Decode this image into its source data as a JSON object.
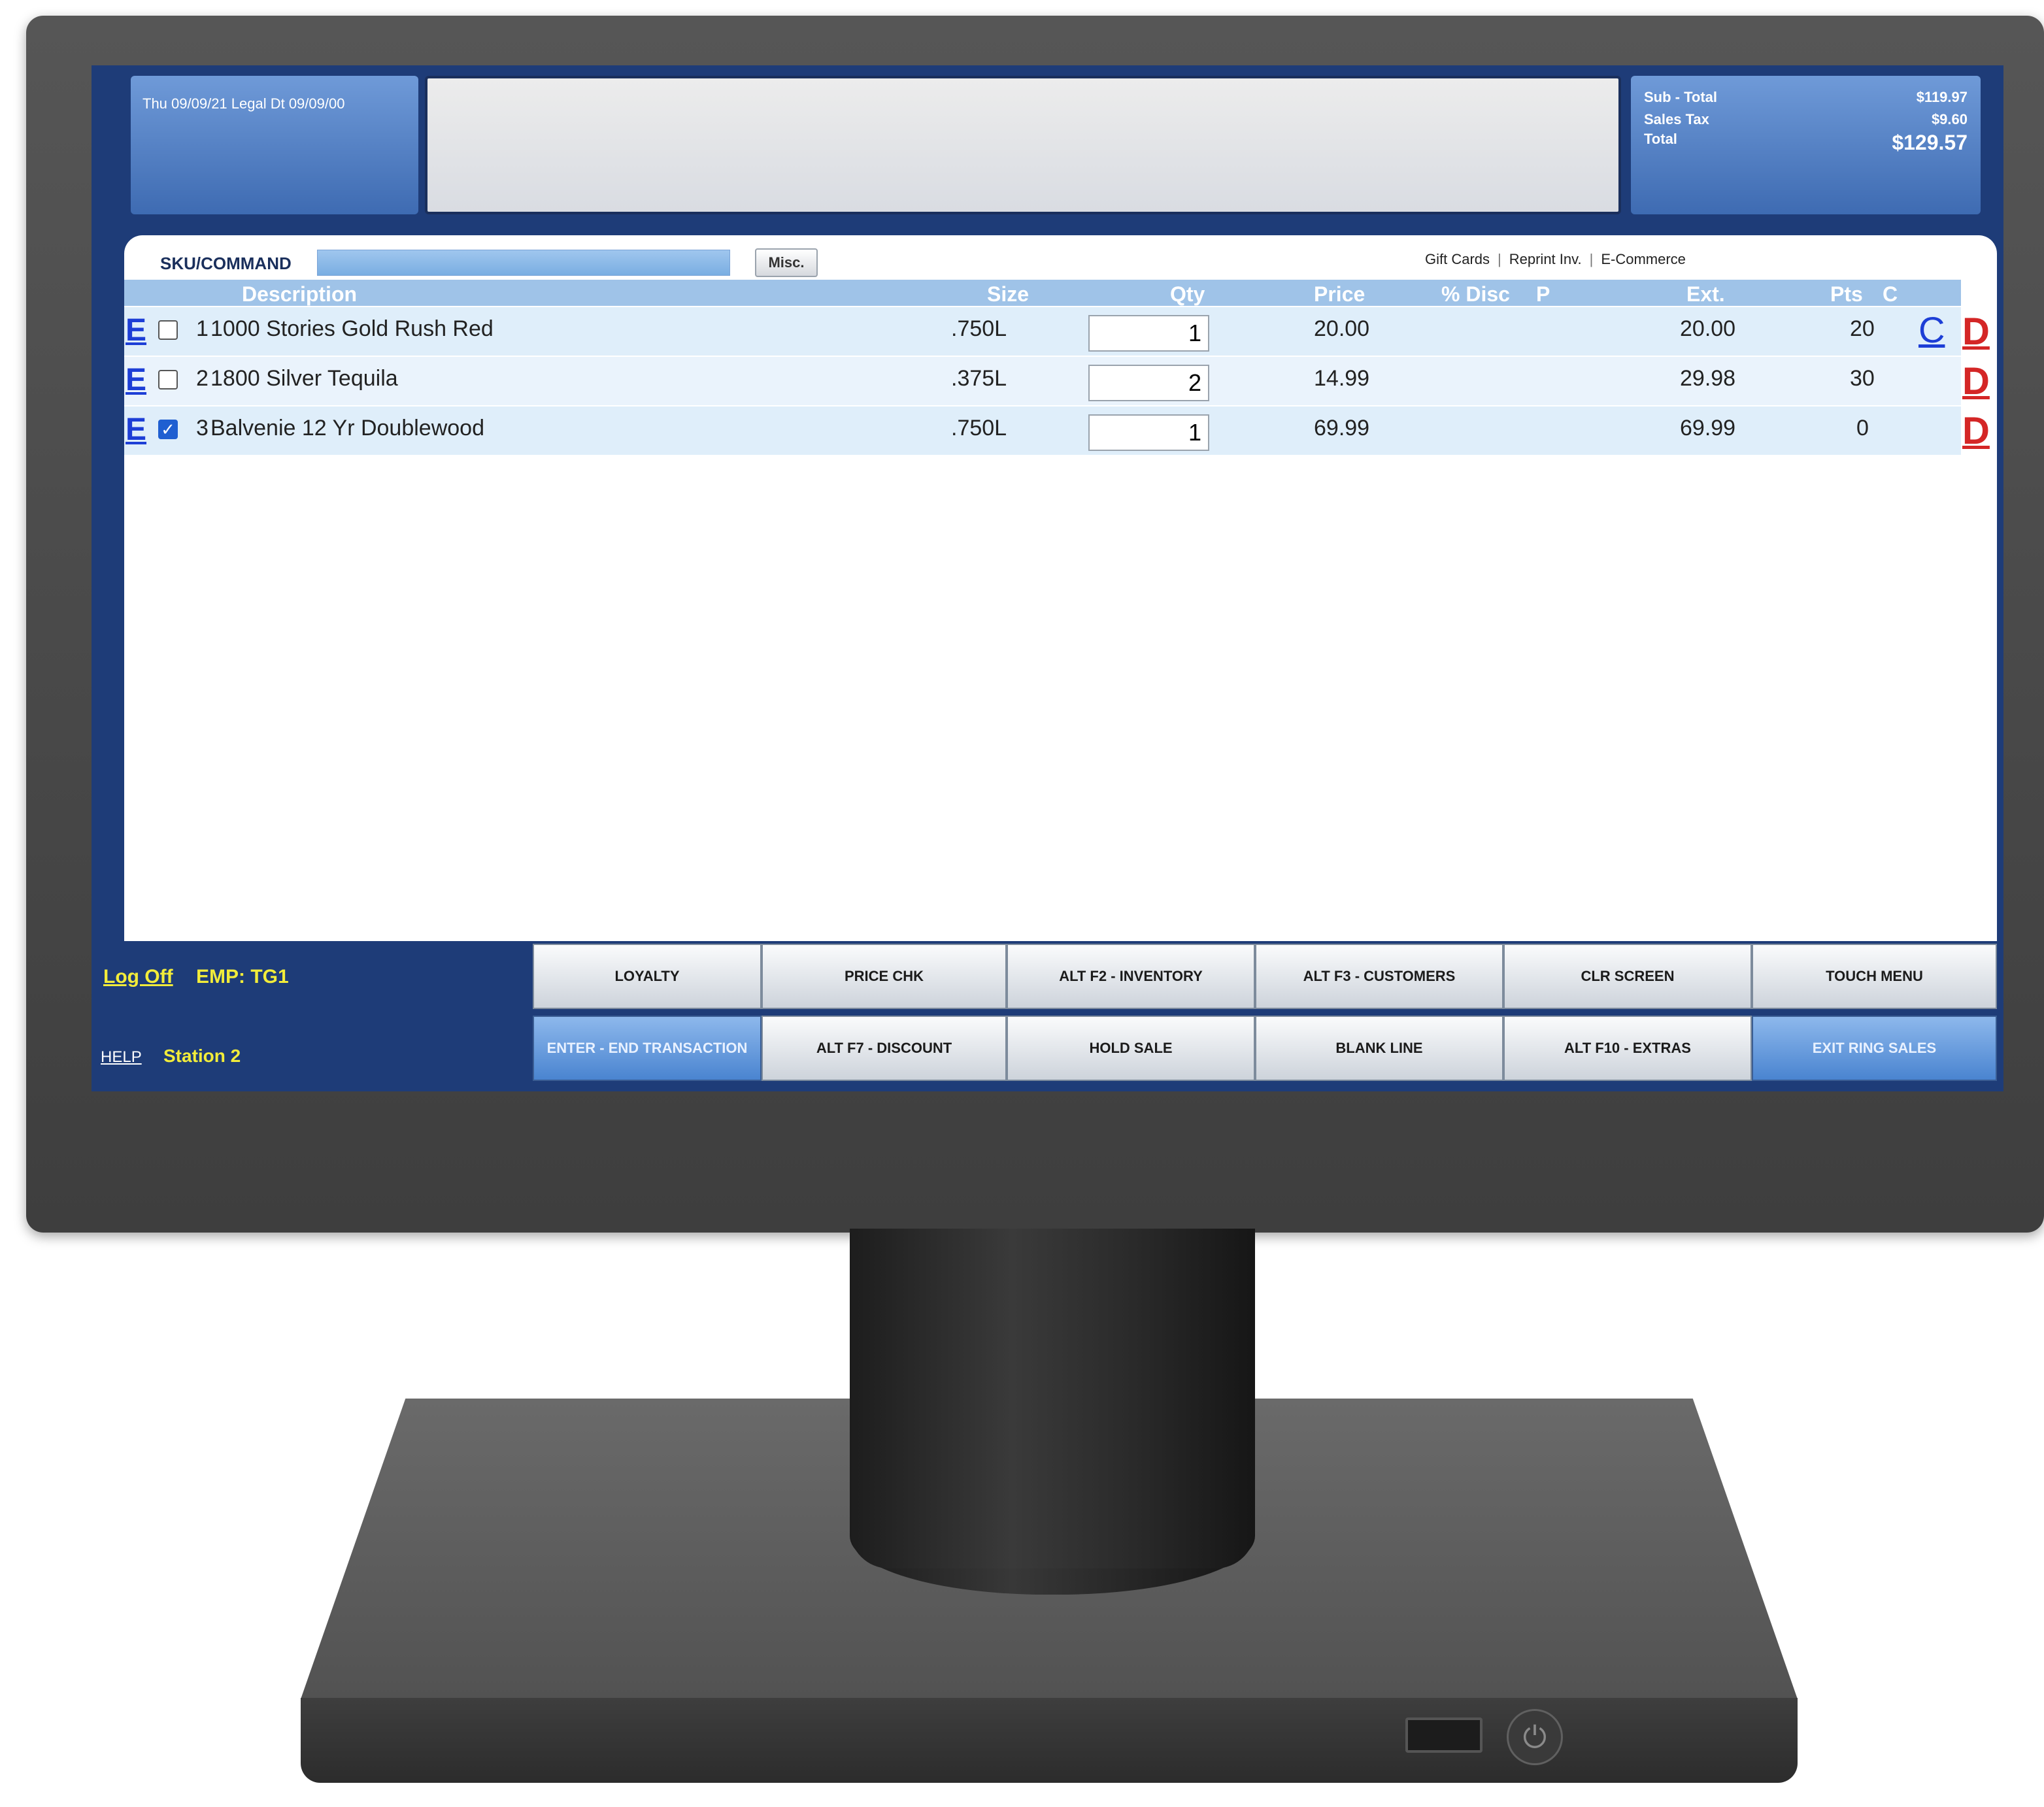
{
  "header": {
    "date_line": "Thu 09/09/21   Legal Dt 09/09/00"
  },
  "totals": {
    "subtotal_label": "Sub - Total",
    "subtotal_value": "$119.97",
    "tax_label": "Sales Tax",
    "tax_value": "$9.60",
    "total_label": "Total",
    "total_value": "$129.57"
  },
  "command": {
    "sku_label": "SKU/COMMAND",
    "misc_label": "Misc.",
    "links": [
      "Gift Cards",
      "Reprint Inv.",
      "E-Commerce"
    ]
  },
  "grid": {
    "headers": {
      "description": "Description",
      "size": "Size",
      "qty": "Qty",
      "price": "Price",
      "disc": "% Disc",
      "p": "P",
      "ext": "Ext.",
      "pts": "Pts",
      "c": "C"
    },
    "rows": [
      {
        "num": "1",
        "description": "1000 Stories Gold Rush Red",
        "size": ".750L",
        "qty": "1",
        "price": "20.00",
        "ext": "20.00",
        "pts": "20",
        "checked": false,
        "c": "C",
        "d": "D",
        "e": "E"
      },
      {
        "num": "2",
        "description": "1800 Silver Tequila",
        "size": ".375L",
        "qty": "2",
        "price": "14.99",
        "ext": "29.98",
        "pts": "30",
        "checked": false,
        "c": "",
        "d": "D",
        "e": "E"
      },
      {
        "num": "3",
        "description": "Balvenie 12 Yr Doublewood",
        "size": ".750L",
        "qty": "1",
        "price": "69.99",
        "ext": "69.99",
        "pts": "0",
        "checked": true,
        "c": "",
        "d": "D",
        "e": "E"
      }
    ]
  },
  "footer": {
    "logoff": "Log Off",
    "emp": "EMP: TG1",
    "help": "HELP",
    "station": "Station 2",
    "buttons_row1": [
      "Loyalty",
      "PRICE CHK",
      "Alt F2 - INVENTORY",
      "Alt F3 - CUSTOMERS",
      "CLR SCREEN",
      "TOUCH MENU"
    ],
    "buttons_row2": [
      "Enter - End transaction",
      "Alt F7 - DISCOUNT",
      "HOLD SALE",
      "BLANK LINE",
      "Alt F10 - EXTRAS",
      "EXIT RING SALES"
    ]
  },
  "icons": {
    "power": "power-icon",
    "usb": "usb-port-icon"
  },
  "colors": {
    "header_blue": "#1e3c78",
    "accent_blue": "#4a84d0",
    "footer_text_yellow": "#f2ec3a",
    "delete_red": "#d42626"
  }
}
